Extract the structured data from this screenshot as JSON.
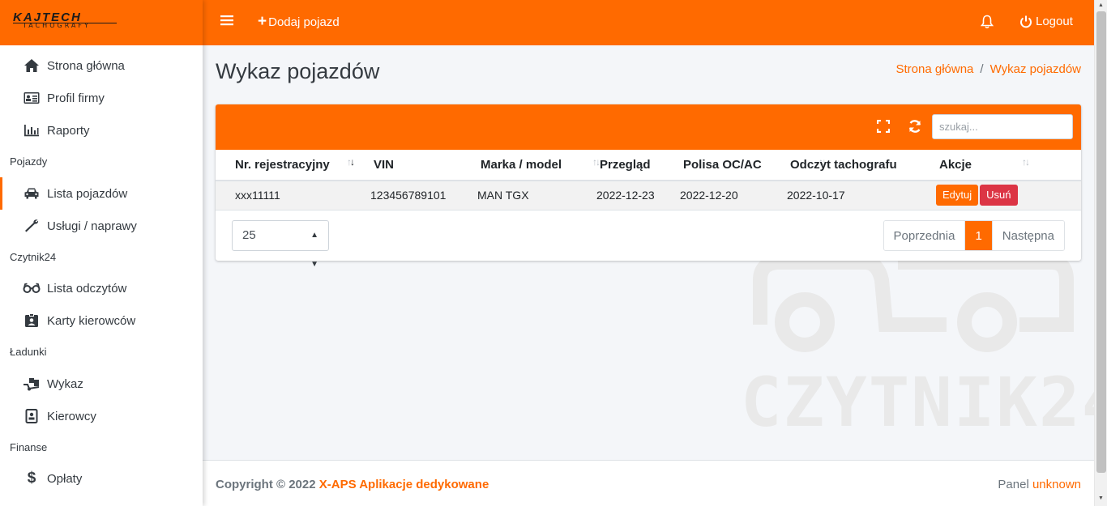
{
  "brand": {
    "logo": "KAJTECH",
    "sub": "TACHOGRAFY"
  },
  "topbar": {
    "add_label": "Dodaj pojazd",
    "logout_label": "Logout"
  },
  "sidebar": {
    "items": [
      {
        "label": "Strona główna",
        "icon": "home-icon"
      },
      {
        "label": "Profil firmy",
        "icon": "id-card-icon"
      },
      {
        "label": "Raporty",
        "icon": "chart-bar-icon"
      },
      {
        "label": "Lista pojazdów",
        "icon": "car-icon"
      },
      {
        "label": "Usługi / naprawy",
        "icon": "wrench-icon"
      },
      {
        "label": "Lista odczytów",
        "icon": "glasses-icon"
      },
      {
        "label": "Karty kierowców",
        "icon": "id-badge-icon"
      },
      {
        "label": "Wykaz",
        "icon": "dolly-icon"
      },
      {
        "label": "Kierowcy",
        "icon": "address-card-icon"
      },
      {
        "label": "Opłaty",
        "icon": "dollar-icon"
      }
    ],
    "sections": [
      "Pojazdy",
      "Czytnik24",
      "Ładunki",
      "Finanse"
    ]
  },
  "page": {
    "title": "Wykaz pojazdów",
    "breadcrumb": [
      "Strona główna",
      "Wykaz pojazdów"
    ]
  },
  "search": {
    "placeholder": "szukaj..."
  },
  "table": {
    "columns": [
      "Nr. rejestracyjny",
      "VIN",
      "Marka / model",
      "Przegląd",
      "Polisa OC/AC",
      "Odczyt tachografu",
      "Akcje"
    ],
    "rows": [
      {
        "reg": "xxx11111",
        "vin": "123456789101",
        "model": "MAN TGX",
        "inspection": "2022-12-23",
        "policy": "2022-12-20",
        "tacho": "2022-10-17",
        "edit": "Edytuj",
        "delete": "Usuń"
      }
    ]
  },
  "pagination": {
    "page_size": "25",
    "prev": "Poprzednia",
    "current": "1",
    "next": "Następna"
  },
  "watermark": {
    "text": "CZYTNIK24"
  },
  "footer": {
    "copyright": "Copyright © 2022",
    "company": "X-APS Aplikacje dedykowane",
    "panel_label": "Panel",
    "panel_value": "unknown"
  },
  "colors": {
    "accent": "#ff6a00",
    "danger": "#dc3545"
  }
}
